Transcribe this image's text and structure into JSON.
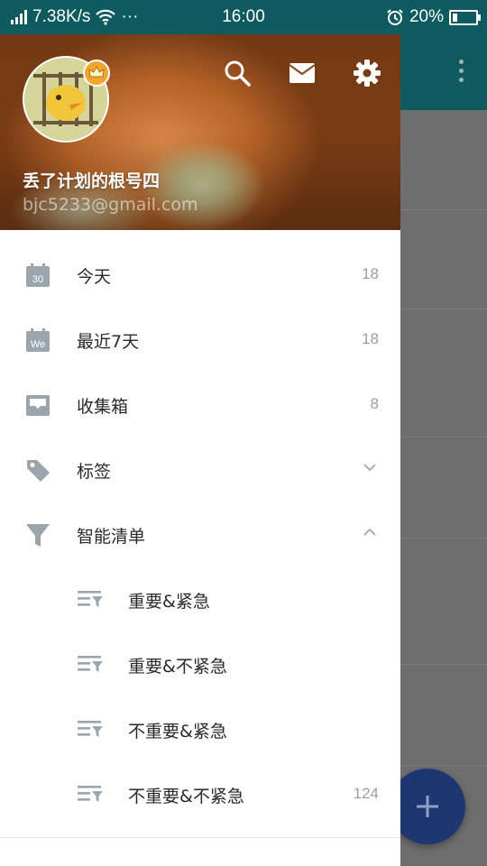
{
  "status_bar": {
    "speed": "7.38K/s",
    "more": "···",
    "time": "16:00",
    "battery": "20%"
  },
  "drawer": {
    "user_name": "丢了计划的根号四",
    "user_email": "bjc5233@gmail.com",
    "menu": [
      {
        "label": "今天",
        "count": "18",
        "icon": "calendar-30-icon",
        "icon_text": "30"
      },
      {
        "label": "最近7天",
        "count": "18",
        "icon": "calendar-week-icon",
        "icon_text": "We"
      },
      {
        "label": "收集箱",
        "count": "8",
        "icon": "inbox-icon"
      },
      {
        "label": "标签",
        "count": "",
        "icon": "tag-icon"
      },
      {
        "label": "智能清单",
        "count": "",
        "icon": "filter-icon"
      }
    ],
    "smart_lists": [
      {
        "label": "重要&紧急",
        "count": ""
      },
      {
        "label": "重要&不紧急",
        "count": ""
      },
      {
        "label": "不重要&紧急",
        "count": ""
      },
      {
        "label": "不重要&不紧急",
        "count": "124"
      }
    ]
  },
  "colors": {
    "teal": "#0f5a5e",
    "icon_gray": "#9aa5ac",
    "fab": "#1e3773"
  }
}
